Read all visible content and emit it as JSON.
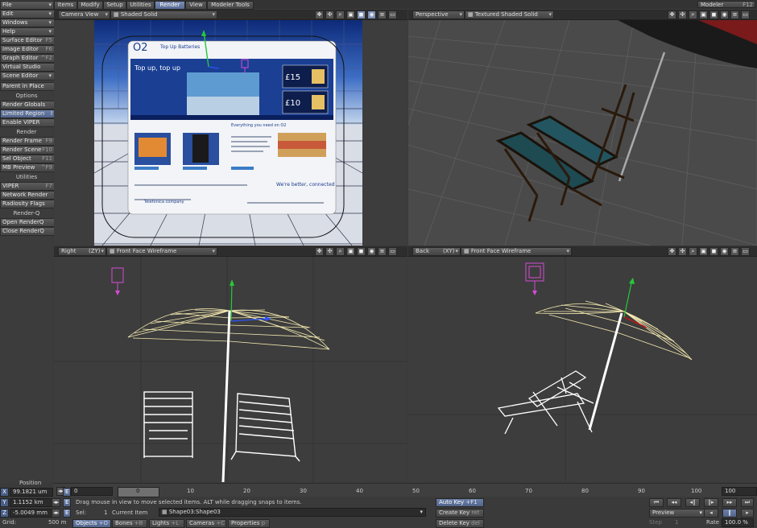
{
  "left_menu": {
    "file": "File",
    "edit": "Edit",
    "windows": "Windows",
    "help": "Help",
    "surface_editor": {
      "label": "Surface Editor",
      "shortcut": "F5"
    },
    "image_editor": {
      "label": "Image Editor",
      "shortcut": "F6"
    },
    "graph_editor": {
      "label": "Graph Editor",
      "shortcut": "^F2"
    },
    "virtual_studio": "Virtual Studio",
    "scene_editor": "Scene Editor",
    "parent_in_place": "Parent in Place",
    "options_header": "Options",
    "render_globals": "Render Globals",
    "limited_region": {
      "label": "Limited Region",
      "shortcut": "l"
    },
    "enable_viper": "Enable VIPER",
    "render_header": "Render",
    "render_frame": {
      "label": "Render Frame",
      "shortcut": "F9"
    },
    "render_scene": {
      "label": "Render Scene",
      "shortcut": "F10"
    },
    "sel_object": {
      "label": "Sel Object",
      "shortcut": "F11"
    },
    "mb_preview": {
      "label": "MB Preview",
      "shortcut": "^F9"
    },
    "utilities_header": "Utilities",
    "viper": {
      "label": "VIPER",
      "shortcut": "F7"
    },
    "network_render": "Network Render",
    "radiosity_flags": "Radiosity Flags",
    "renderq_header": "Render-Q",
    "open_renderq": "Open RenderQ",
    "close_renderq": "Close RenderQ"
  },
  "tabs": [
    "Items",
    "Modify",
    "Setup",
    "Utilities",
    "Render",
    "View",
    "Modeler Tools"
  ],
  "active_tab": "Render",
  "modeler": {
    "label": "Modeler",
    "shortcut": "F12"
  },
  "viewports": {
    "top_left": {
      "view": "Camera View",
      "mode": "Shaded Solid"
    },
    "top_right": {
      "view": "Perspective",
      "mode": "Textured Shaded Solid"
    },
    "bottom_left": {
      "view": "Right",
      "axis": "(ZY)",
      "mode": "Front Face Wireframe"
    },
    "bottom_right": {
      "view": "Back",
      "axis": "(XY)",
      "mode": "Front Face Wireframe"
    }
  },
  "billboard": {
    "brand": "O2",
    "tagline": "Top Up Batteries",
    "headline": "Top up, top up",
    "price1": "£15",
    "price2": "£10",
    "sub_caption": "Everything you need on O2",
    "footer_tagline": "We're better, connected",
    "company": "Telefonica company"
  },
  "timeline": {
    "ticks": [
      "0",
      "10",
      "20",
      "30",
      "40",
      "50",
      "60",
      "70",
      "80",
      "90",
      "100"
    ],
    "current_frame": "0",
    "start": "0",
    "end": "100"
  },
  "position": {
    "label": "Position",
    "x": {
      "axis": "X",
      "value": "99.1821 um"
    },
    "y": {
      "axis": "Y",
      "value": "1.1152 km"
    },
    "z": {
      "axis": "Z",
      "value": "-5.0049 mm"
    },
    "grid_label": "Grid:",
    "grid_value": "500 m"
  },
  "status": {
    "message": "Drag mouse in view to move selected items. ALT while dragging snaps to items.",
    "sel_label": "Sel:",
    "sel_value": "1",
    "current_item_label": "Current Item",
    "current_item": "Shape03:Shape03"
  },
  "item_tabs": [
    {
      "label": "Objects",
      "shortcut": "+O"
    },
    {
      "label": "Bones",
      "shortcut": "+B"
    },
    {
      "label": "Lights",
      "shortcut": "+L"
    },
    {
      "label": "Cameras",
      "shortcut": "+C"
    },
    {
      "label": "Properties",
      "shortcut": "p"
    }
  ],
  "keys": {
    "auto_key": {
      "label": "Auto Key",
      "shortcut": "+F1"
    },
    "create_key": {
      "label": "Create Key",
      "shortcut": "ret"
    },
    "delete_key": {
      "label": "Delete Key",
      "shortcut": "del"
    }
  },
  "playback": {
    "preview": "Preview",
    "step_label": "Step",
    "rate_label": "Rate",
    "rate_value": "100.0 %",
    "step_value": "1"
  },
  "colors": {
    "accent": "#5a6d96",
    "wire": "#f5eab0",
    "grid_bg": "#3d3d3d"
  }
}
